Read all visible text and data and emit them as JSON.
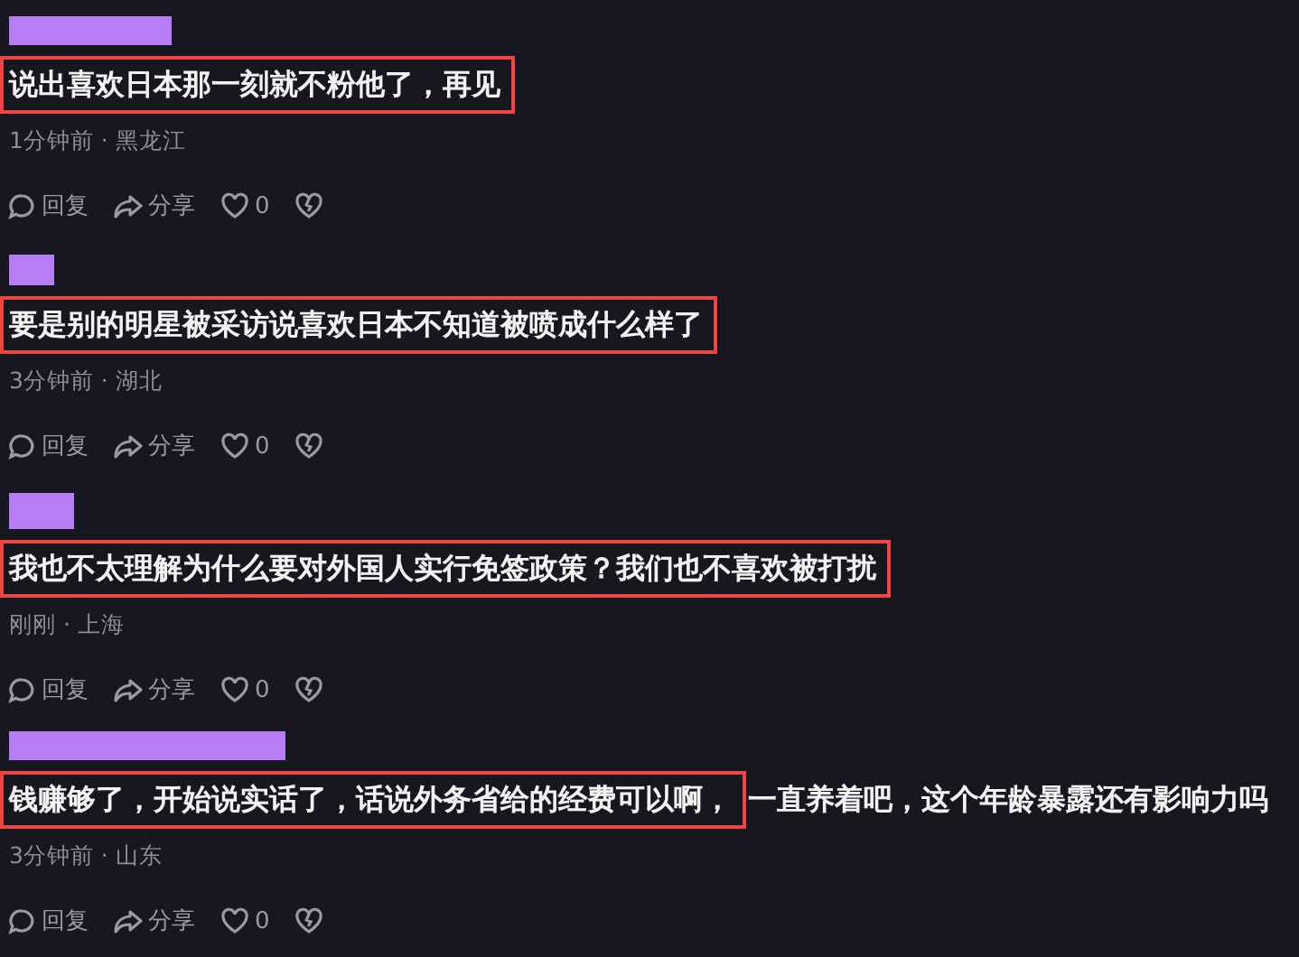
{
  "comments": [
    {
      "segments": [
        {
          "text": "说出喜欢日本那一刻就不粉他了，再见",
          "highlighted": true
        }
      ],
      "meta": "1分钟前 · 黑龙江",
      "reply": "回复",
      "share": "分享",
      "likes": "0"
    },
    {
      "segments": [
        {
          "text": "要是别的明星被采访说喜欢日本不知道被喷成什么样了",
          "highlighted": true
        }
      ],
      "meta": "3分钟前 · 湖北",
      "reply": "回复",
      "share": "分享",
      "likes": "0"
    },
    {
      "segments": [
        {
          "text": "我也不太理解为什么要对外国人实行免签政策？我们也不喜欢被打扰",
          "highlighted": true
        }
      ],
      "meta": "刚刚 · 上海",
      "reply": "回复",
      "share": "分享",
      "likes": "0"
    },
    {
      "segments": [
        {
          "text": "钱赚够了，开始说实话了，话说外务省给的经费可以啊，",
          "highlighted": true
        },
        {
          "text": "一直养着吧，这个年龄暴露还有影响力吗",
          "highlighted": false
        }
      ],
      "meta": "3分钟前 · 山东",
      "reply": "回复",
      "share": "分享",
      "likes": "0"
    }
  ]
}
